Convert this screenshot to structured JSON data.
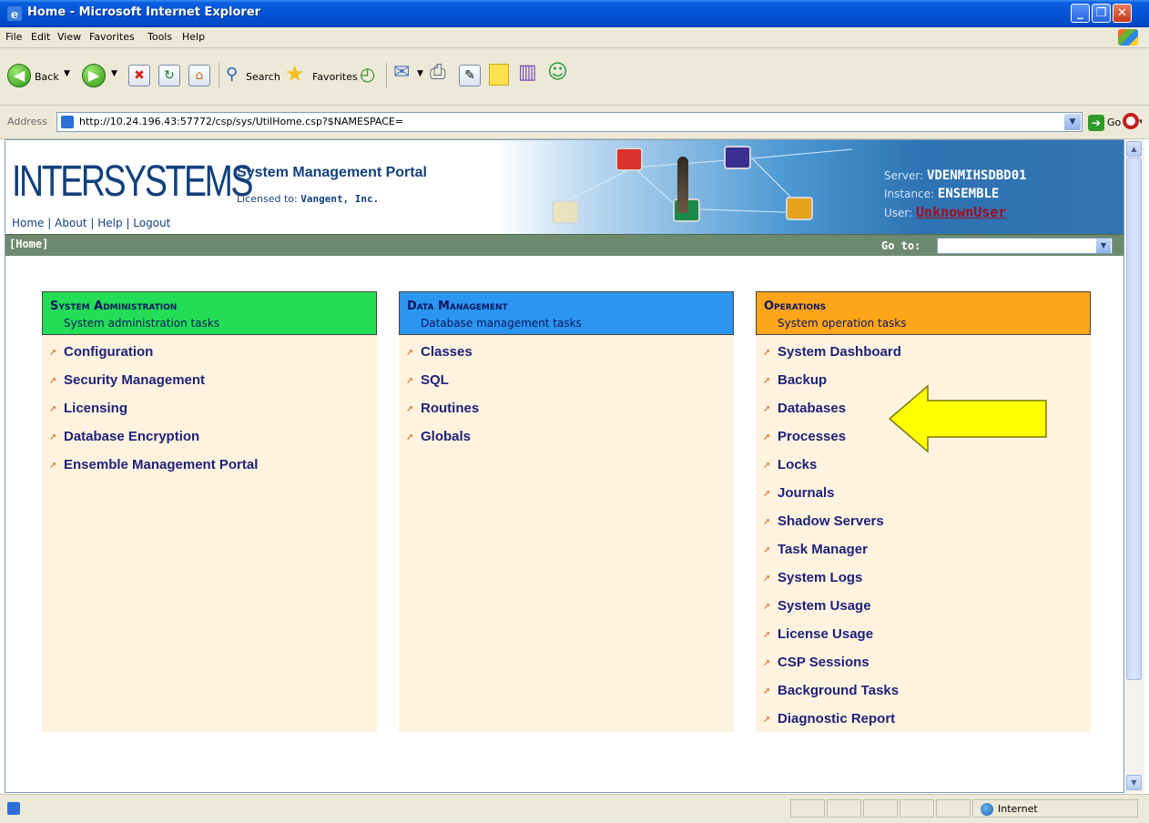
{
  "window": {
    "title": "Home - Microsoft Internet Explorer",
    "controls": [
      "minimize",
      "maximize",
      "close"
    ]
  },
  "menubar": {
    "items": [
      "File",
      "Edit",
      "View",
      "Favorites",
      "Tools",
      "Help"
    ]
  },
  "toolbar": {
    "back_label": "Back",
    "search_label": "Search",
    "favorites_label": "Favorites"
  },
  "address_bar": {
    "label": "Address",
    "url": "http://10.24.196.43:57772/csp/sys/UtilHome.csp?$NAMESPACE=",
    "go_label": "Go"
  },
  "portal": {
    "logo": "INTERSYSTEMS",
    "nav_links": [
      "Home",
      "About",
      "Help",
      "Logout"
    ],
    "title": "System Management Portal",
    "license_label": "Licensed to:",
    "license_value": "Vangent, Inc.",
    "server_label": "Server:",
    "server_value": "VDENMIHSDBD01",
    "instance_label": "Instance:",
    "instance_value": "ENSEMBLE",
    "user_label": "User:",
    "user_value": "UnknownUser",
    "breadcrumb": "[Home]",
    "goto_label": "Go to:",
    "goto_value": ""
  },
  "menus": [
    {
      "title": "System Administration",
      "subtitle": "System administration tasks",
      "color": "#22dd55",
      "items": [
        "Configuration",
        "Security Management",
        "Licensing",
        "Database Encryption",
        "Ensemble Management Portal"
      ]
    },
    {
      "title": "Data Management",
      "subtitle": "Database management tasks",
      "color": "#2b96f0",
      "items": [
        "Classes",
        "SQL",
        "Routines",
        "Globals"
      ]
    },
    {
      "title": "Operations",
      "subtitle": "System operation tasks",
      "color": "#ffa51a",
      "items": [
        "System Dashboard",
        "Backup",
        "Databases",
        "Processes",
        "Locks",
        "Journals",
        "Shadow Servers",
        "Task Manager",
        "System Logs",
        "System Usage",
        "License Usage",
        "CSP Sessions",
        "Background Tasks",
        "Diagnostic Report"
      ]
    }
  ],
  "annotation": {
    "arrow_color": "#ffff00",
    "points_to": "Databases"
  },
  "statusbar": {
    "zone": "Internet"
  }
}
